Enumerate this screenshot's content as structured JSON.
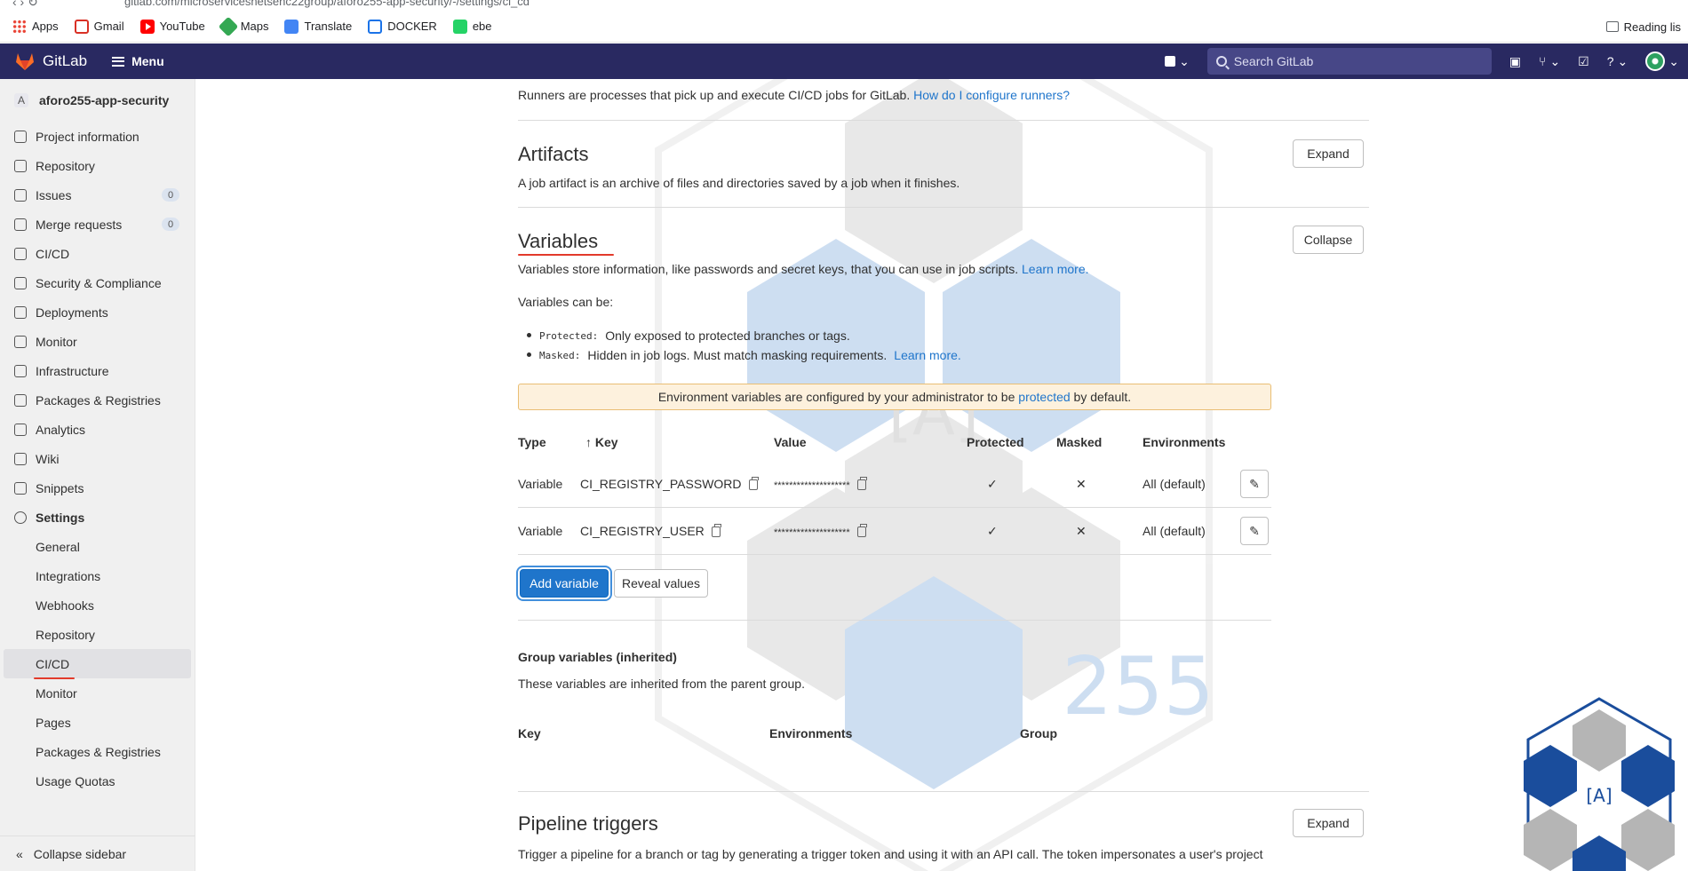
{
  "browser": {
    "url": "gitlab.com/microservicesnetsehc22group/aforo255-app-security/-/settings/ci_cd",
    "bookmarks": [
      "Apps",
      "Gmail",
      "YouTube",
      "Maps",
      "Translate",
      "DOCKER",
      "ebe"
    ],
    "reading_list": "Reading lis"
  },
  "topbar": {
    "brand": "GitLab",
    "menu": "Menu",
    "search_placeholder": "Search GitLab"
  },
  "sidebar": {
    "project_initial": "A",
    "project_name": "aforo255-app-security",
    "items": [
      {
        "label": "Project information",
        "icon": "info-icon"
      },
      {
        "label": "Repository",
        "icon": "doc-icon"
      },
      {
        "label": "Issues",
        "icon": "issues-icon",
        "count": "0"
      },
      {
        "label": "Merge requests",
        "icon": "merge-icon",
        "count": "0"
      },
      {
        "label": "CI/CD",
        "icon": "rocket-icon"
      },
      {
        "label": "Security & Compliance",
        "icon": "shield-icon"
      },
      {
        "label": "Deployments",
        "icon": "deploy-icon"
      },
      {
        "label": "Monitor",
        "icon": "monitor-icon"
      },
      {
        "label": "Infrastructure",
        "icon": "cloud-icon"
      },
      {
        "label": "Packages & Registries",
        "icon": "package-icon"
      },
      {
        "label": "Analytics",
        "icon": "chart-icon"
      },
      {
        "label": "Wiki",
        "icon": "book-icon"
      },
      {
        "label": "Snippets",
        "icon": "scissors-icon"
      },
      {
        "label": "Settings",
        "icon": "gear-icon"
      }
    ],
    "settings_sub": [
      "General",
      "Integrations",
      "Webhooks",
      "Repository",
      "CI/CD",
      "Monitor",
      "Pages",
      "Packages & Registries",
      "Usage Quotas"
    ],
    "collapse": "Collapse sidebar"
  },
  "main": {
    "runners_text": "Runners are processes that pick up and execute CI/CD jobs for GitLab.",
    "runners_link": "How do I configure runners?",
    "artifacts": {
      "title": "Artifacts",
      "desc": "A job artifact is an archive of files and directories saved by a job when it finishes.",
      "button": "Expand"
    },
    "variables": {
      "title": "Variables",
      "button": "Collapse",
      "desc": "Variables store information, like passwords and secret keys, that you can use in job scripts.",
      "desc_link": "Learn more.",
      "can_be": "Variables can be:",
      "bullet1_code": "Protected:",
      "bullet1_text": "Only exposed to protected branches or tags.",
      "bullet2_code": "Masked:",
      "bullet2_text": "Hidden in job logs. Must match masking requirements.",
      "bullet2_link": "Learn more.",
      "alert_pre": "Environment variables are configured by your administrator to be",
      "alert_link": "protected",
      "alert_post": "by default.",
      "columns": [
        "Type",
        "Key",
        "Value",
        "Protected",
        "Masked",
        "Environments"
      ],
      "sort_arrow": "↑",
      "rows": [
        {
          "type": "Variable",
          "key": "CI_REGISTRY_PASSWORD",
          "value": "********************",
          "protected": "✓",
          "masked": "✕",
          "env": "All (default)"
        },
        {
          "type": "Variable",
          "key": "CI_REGISTRY_USER",
          "value": "********************",
          "protected": "✓",
          "masked": "✕",
          "env": "All (default)"
        }
      ],
      "add_button": "Add variable",
      "reveal_button": "Reveal values"
    },
    "group_vars": {
      "title": "Group variables (inherited)",
      "desc": "These variables are inherited from the parent group.",
      "columns": [
        "Key",
        "Environments",
        "Group"
      ]
    },
    "pipeline_triggers": {
      "title": "Pipeline triggers",
      "button": "Expand",
      "desc": "Trigger a pipeline for a branch or tag by generating a trigger token and using it with an API call. The token impersonates a user's project"
    },
    "watermark_text": "[A]",
    "watermark_num": "255"
  },
  "colors": {
    "topbar": "#292961",
    "link": "#1f75cb",
    "alert_bg": "#fdf1dd",
    "annotation": "#e23a2b"
  }
}
